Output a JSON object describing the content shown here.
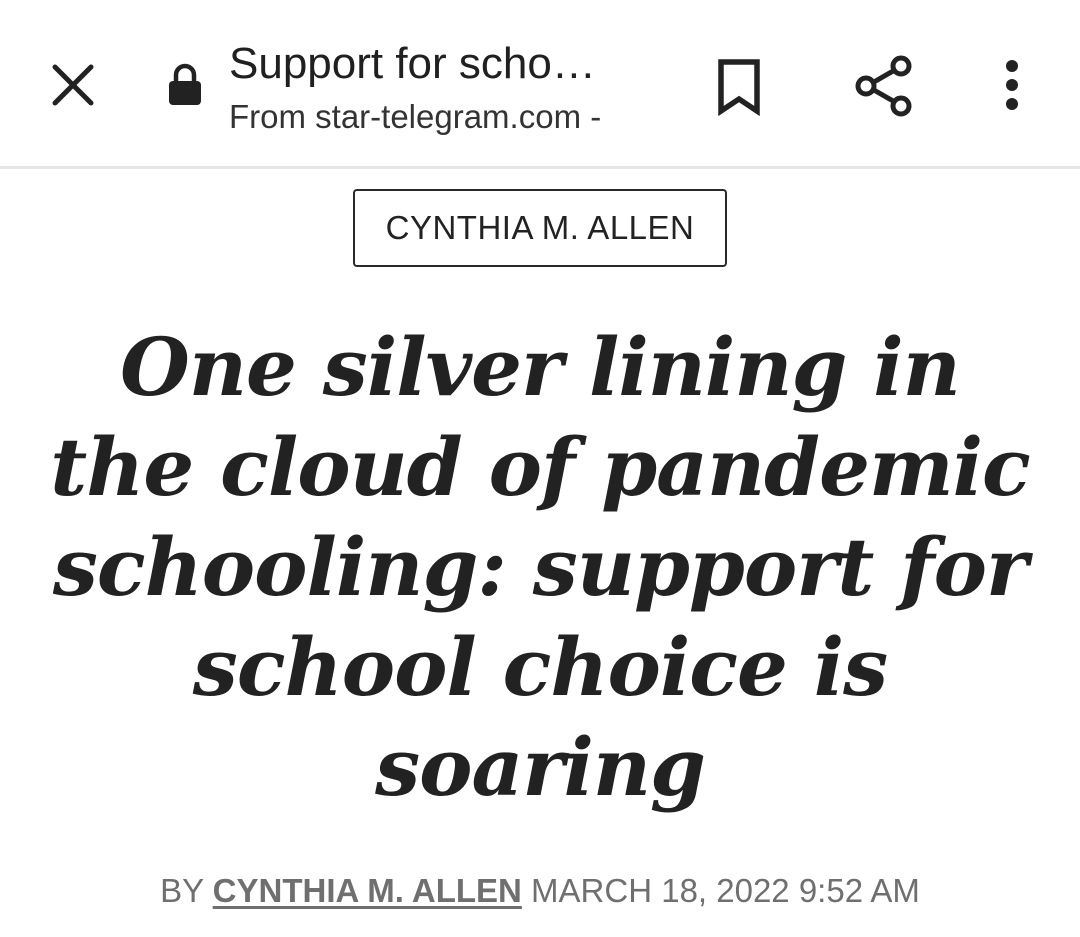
{
  "toolbar": {
    "title": "Support for scho…",
    "source": "From star-telegram.com -",
    "close_icon": "close-icon",
    "lock_icon": "lock-icon",
    "bookmark_icon": "bookmark-icon",
    "share_icon": "share-icon",
    "more_icon": "more-vertical-icon"
  },
  "article": {
    "author_tag": "CYNTHIA M. ALLEN",
    "headline": "One silver lining in the cloud of pandemic schooling: support for school choice is soaring",
    "byline": {
      "prefix": "BY",
      "author": "CYNTHIA M. ALLEN",
      "datetime": "MARCH 18, 2022 9:52 AM"
    }
  },
  "colors": {
    "text": "#222222",
    "muted": "#6f6f6f",
    "divider": "#e6e6e6",
    "background": "#ffffff"
  }
}
